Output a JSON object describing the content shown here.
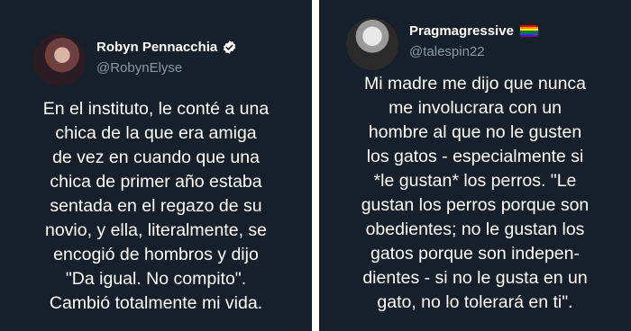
{
  "tweets": [
    {
      "author": {
        "name": "Robyn Pennacchia",
        "handle": "@RobynElyse",
        "badge": "verified-icon"
      },
      "text_lines": [
        "En el instituto, le conté a una",
        "chica de la que era amiga",
        "de vez en cuando que una",
        "chica de primer año estaba",
        "sentada en el regazo de su",
        "novio, y ella, literalmente, se",
        "encogió de hombros y dijo",
        "\"Da igual. No compito\".",
        "Cambió totalmente mi vida."
      ]
    },
    {
      "author": {
        "name": "Pragmagressive",
        "handle": "@talespin22",
        "badge": "rainbow-flag-icon"
      },
      "text_lines": [
        "Mi madre me dijo que nunca",
        "me involucrara con un",
        "hombre al que no le gusten",
        "los gatos - especialmente si",
        "*le gustan* los perros. \"Le",
        "gustan los perros porque son",
        "obedientes; no le gustan los",
        "gatos porque son indepen-",
        "dientes - si no le gusta en un",
        "gato, no lo tolerará en ti\"."
      ]
    }
  ],
  "colors": {
    "card_background": "#15202b",
    "text": "#ffffff",
    "handle": "#8899a6",
    "verified": "#ffffff"
  }
}
